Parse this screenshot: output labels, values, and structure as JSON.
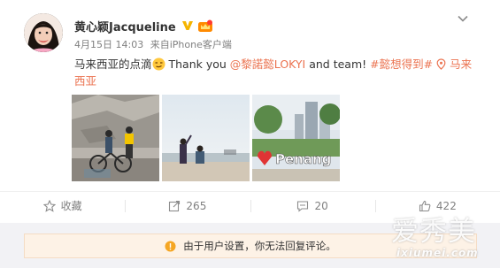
{
  "post": {
    "username": "黄心颖Jacqueline",
    "date": "4月15日 14:03",
    "source_prefix": "来自",
    "source": "iPhone客户端",
    "text_before": "马来西亚的点滴",
    "text_middle": " Thank you ",
    "mention": "@黎諾懿LOKYI",
    "text_after": " and team! ",
    "hashtag": "#懿想得到#",
    "location": "马来西亚",
    "emoji": "smirk-emoji",
    "photos": [
      {
        "name": "street-art-photo"
      },
      {
        "name": "seaside-photo"
      },
      {
        "name": "i-love-penang-photo",
        "sign_text": "Penang"
      }
    ]
  },
  "actions": {
    "favorite_label": "收藏",
    "repost_count": "265",
    "comment_count": "20",
    "like_count": "422"
  },
  "notice": {
    "text": "由于用户设置，你无法回复评论。"
  },
  "watermark": {
    "main": "爱秀美",
    "sub": "ixiumei.com"
  },
  "colors": {
    "link": "#eb7350",
    "muted": "#808080",
    "notice_bg": "#fdf2e6",
    "warning": "#f5a623",
    "vip_gold": "#f5b400"
  }
}
